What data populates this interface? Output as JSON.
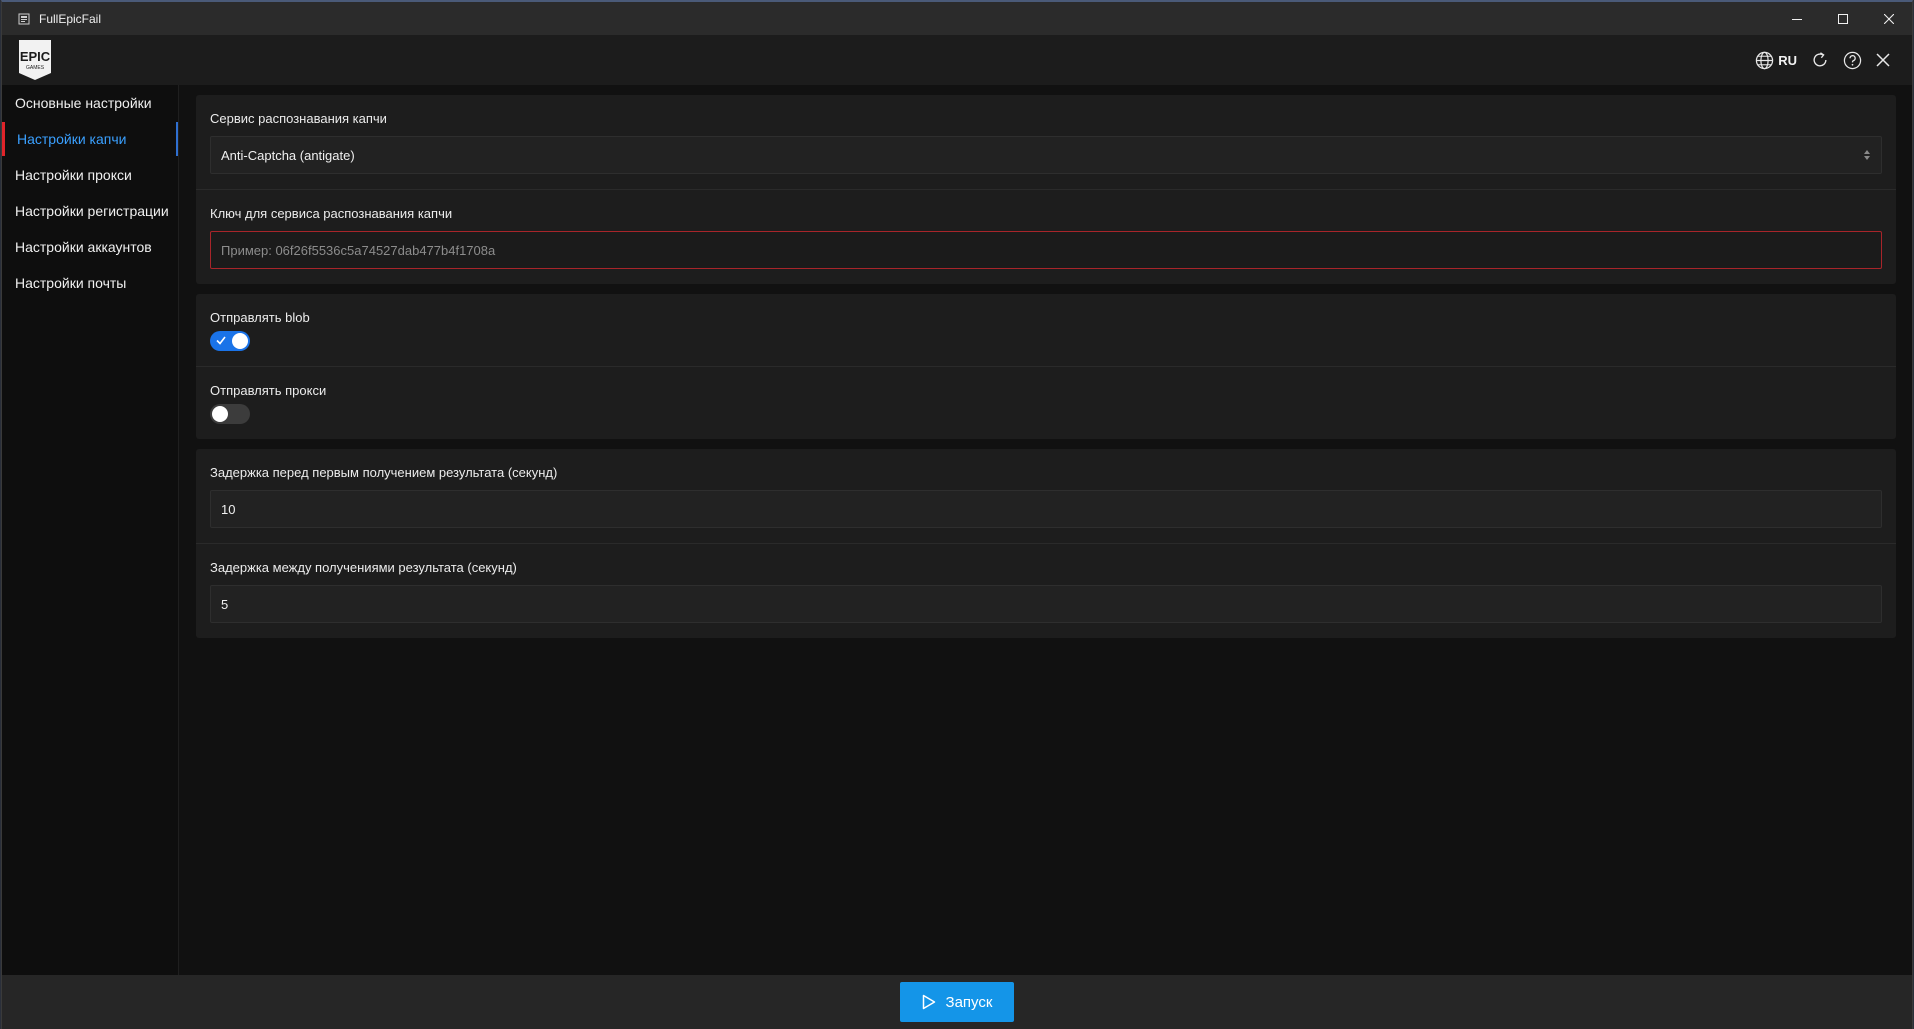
{
  "window": {
    "title": "FullEpicFail",
    "controls": [
      "minimize-icon",
      "maximize-icon",
      "close-icon"
    ]
  },
  "header": {
    "logo": {
      "line1": "EPIC",
      "line2": "GAMES"
    },
    "language": "RU",
    "tools": [
      "globe-icon",
      "refresh-icon",
      "help-icon",
      "close-icon"
    ]
  },
  "sidebar": {
    "items": [
      {
        "label": "Основные настройки",
        "active": false
      },
      {
        "label": "Настройки капчи",
        "active": true
      },
      {
        "label": "Настройки прокси",
        "active": false
      },
      {
        "label": "Настройки регистрации",
        "active": false
      },
      {
        "label": "Настройки аккаунтов",
        "active": false
      },
      {
        "label": "Настройки почты",
        "active": false
      }
    ]
  },
  "captcha": {
    "service_label": "Сервис распознавания капчи",
    "service_value": "Anti-Captcha (antigate)",
    "key_label": "Ключ для сервиса распознавания капчи",
    "key_value": "",
    "key_placeholder": "Пример: 06f26f5536c5a74527dab477b4f1708a",
    "send_blob_label": "Отправлять blob",
    "send_blob": true,
    "send_proxy_label": "Отправлять прокси",
    "send_proxy": false,
    "first_delay_label": "Задержка перед первым получением результата (секунд)",
    "first_delay_value": "10",
    "between_delay_label": "Задержка между получениями результата (секунд)",
    "between_delay_value": "5"
  },
  "footer": {
    "start_label": "Запуск"
  },
  "colors": {
    "accent": "#1495e8",
    "active_nav_text": "#3aa0ff",
    "active_nav_marker": "#e0242a",
    "toggle_on": "#1a73e8",
    "error_border": "#a8252a"
  }
}
